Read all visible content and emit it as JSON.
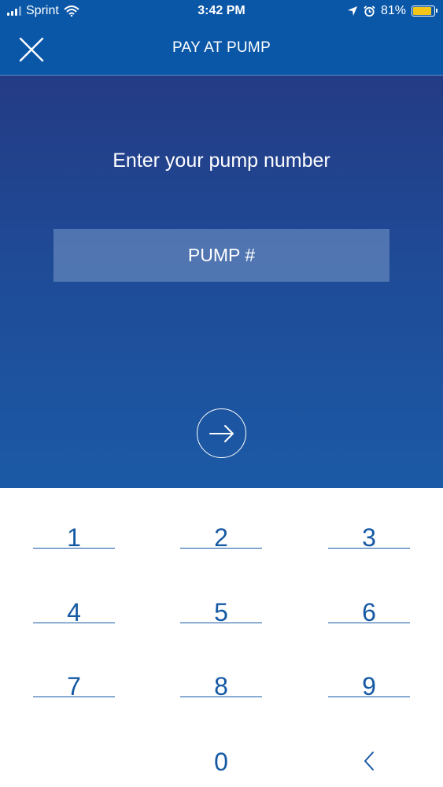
{
  "status_bar": {
    "carrier": "Sprint",
    "time": "3:42 PM",
    "battery_percent": "81%",
    "battery_level": 0.81
  },
  "nav": {
    "title": "PAY AT PUMP",
    "close_icon": "close-icon"
  },
  "hero": {
    "prompt": "Enter your pump number",
    "field_placeholder": "PUMP #",
    "field_value": "",
    "submit_icon": "arrow-right-icon"
  },
  "keypad": {
    "keys": [
      "1",
      "2",
      "3",
      "4",
      "5",
      "6",
      "7",
      "8",
      "9",
      "0"
    ],
    "backspace_icon": "backspace-chevron-icon"
  },
  "colors": {
    "nav_bg": "#0a57a8",
    "hero_top": "#243b85",
    "hero_bottom": "#1b5aa6",
    "keypad_text": "#1559a4",
    "battery_fill": "#f5c518"
  }
}
